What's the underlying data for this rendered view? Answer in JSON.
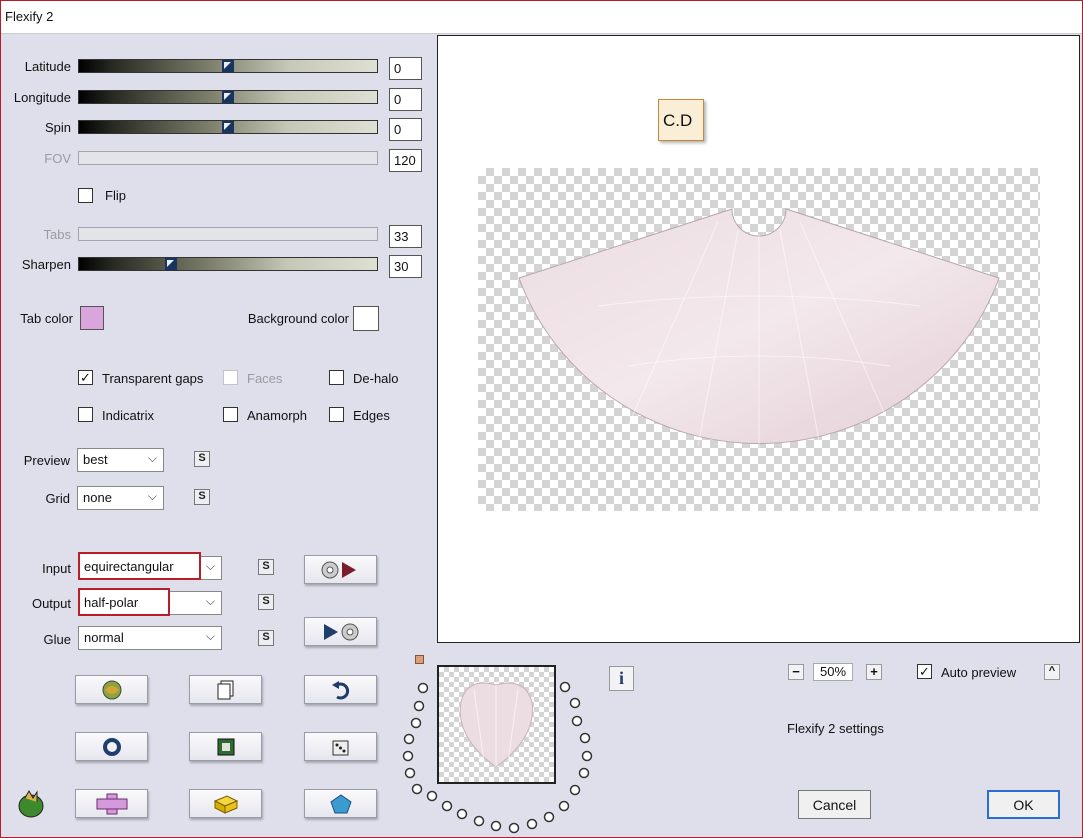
{
  "window": {
    "title": "Flexify 2"
  },
  "sliders": [
    {
      "label": "Latitude",
      "value": "0",
      "position": 0.5,
      "enabled": true
    },
    {
      "label": "Longitude",
      "value": "0",
      "position": 0.5,
      "enabled": true
    },
    {
      "label": "Spin",
      "value": "0",
      "position": 0.5,
      "enabled": true
    },
    {
      "label": "FOV",
      "value": "120",
      "enabled": false
    },
    {
      "label": "Tabs",
      "value": "33",
      "enabled": false
    },
    {
      "label": "Sharpen",
      "value": "30",
      "position": 0.3,
      "enabled": true
    }
  ],
  "flip": {
    "label": "Flip",
    "checked": false
  },
  "colors": {
    "tab_color_label": "Tab color",
    "tab_color": "#d9a5dc",
    "background_color_label": "Background color",
    "background_color": "#ffffff"
  },
  "options": {
    "transparent_gaps": {
      "label": "Transparent gaps",
      "checked": true
    },
    "faces": {
      "label": "Faces",
      "checked": false,
      "enabled": false
    },
    "de_halo": {
      "label": "De-halo",
      "checked": false
    },
    "indicatrix": {
      "label": "Indicatrix",
      "checked": false
    },
    "anamorph": {
      "label": "Anamorph",
      "checked": false
    },
    "edges": {
      "label": "Edges",
      "checked": false
    }
  },
  "selects": {
    "preview": {
      "label": "Preview",
      "value": "best",
      "s": "S"
    },
    "grid": {
      "label": "Grid",
      "value": "none",
      "s": "S"
    },
    "input": {
      "label": "Input",
      "value": "equirectangular",
      "s": "S"
    },
    "output": {
      "label": "Output",
      "value": "half-polar",
      "s": "S"
    },
    "glue": {
      "label": "Glue",
      "value": "normal",
      "s": "S"
    }
  },
  "preview_area": {
    "watermark": "C.D"
  },
  "zoom": {
    "minus": "−",
    "value": "50%",
    "plus": "+"
  },
  "auto_preview": {
    "label": "Auto preview",
    "checked": true,
    "toggle": "^"
  },
  "settings_label": "Flexify 2 settings",
  "info_label": "i",
  "buttons": {
    "cancel": "Cancel",
    "ok": "OK"
  },
  "accent": {
    "highlight_border": "#b81d2c",
    "ok_border": "#2a6fcf"
  }
}
